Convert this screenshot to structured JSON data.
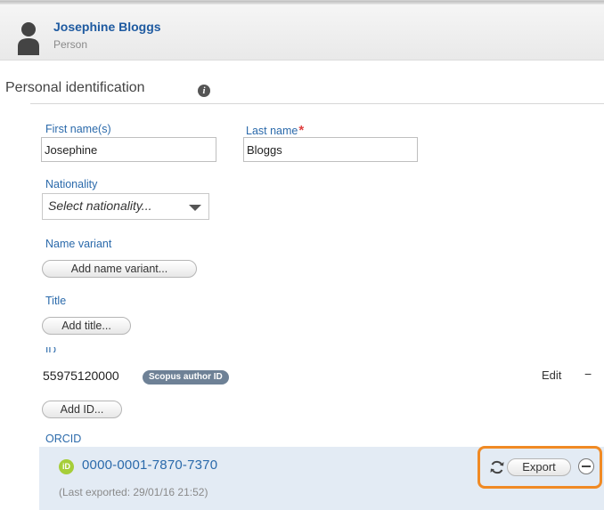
{
  "header": {
    "name": "Josephine Bloggs",
    "type": "Person"
  },
  "section": {
    "title": "Personal identification",
    "info_icon": "i"
  },
  "fields": {
    "first_name_label": "First name(s)",
    "first_name_value": "Josephine",
    "last_name_label": "Last name",
    "required_marker": "*",
    "last_name_value": "Bloggs",
    "nationality_label": "Nationality",
    "nationality_value": "Select nationality...",
    "name_variant_label": "Name variant",
    "add_name_variant": "Add name variant...",
    "title_label": "Title",
    "add_title": "Add title...",
    "id_label": "ID",
    "id_value": "55975120000",
    "id_badge": "Scopus author ID",
    "edit_label": "Edit",
    "remove_symbol": "−",
    "add_id": "Add ID...",
    "orcid_label": "ORCID"
  },
  "orcid": {
    "icon_text": "iD",
    "id": "0000-0001-7870-7370",
    "last_exported": "(Last exported: 29/01/16 21:52)",
    "export_label": "Export"
  },
  "colors": {
    "accent": "#2b6aab",
    "highlight": "#f08a24",
    "orcid_green": "#a6ce39",
    "badge": "#6e8196"
  }
}
